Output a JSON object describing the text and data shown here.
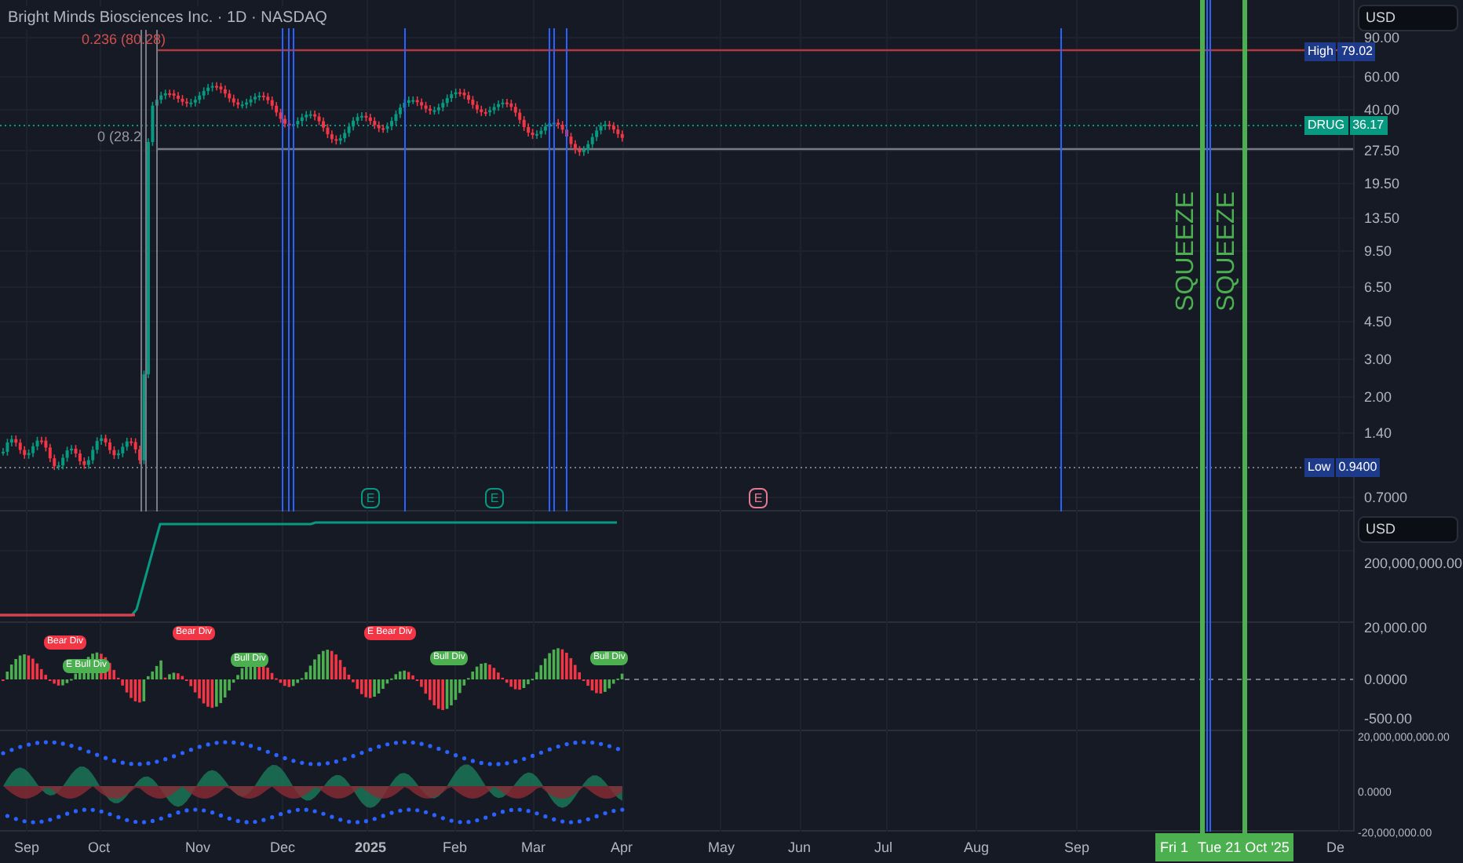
{
  "chart_title": "Bright Minds Biosciences Inc. · 1D · NASDAQ",
  "price_pane": {
    "fib_levels": [
      {
        "kind": "upper",
        "label": "0.236 (80.28)"
      },
      {
        "kind": "base",
        "label": "0 (28.2"
      }
    ],
    "axis_currency": "USD",
    "axis_ticks": [
      "90.00",
      "60.00",
      "40.00",
      "27.50",
      "19.50",
      "13.50",
      "9.50",
      "6.50",
      "4.50",
      "3.00",
      "2.00",
      "1.40",
      "0.7000"
    ],
    "price_labels": [
      {
        "kind": "high",
        "name": "High",
        "value": "79.02"
      },
      {
        "kind": "last",
        "name": "DRUG",
        "value": "36.17"
      },
      {
        "kind": "low",
        "name": "Low",
        "value": "0.9400"
      }
    ],
    "events": [
      {
        "label": "E",
        "color": "#089981"
      },
      {
        "label": "E",
        "color": "#089981"
      },
      {
        "label": "E",
        "color": "#e27a92"
      }
    ],
    "squeeze_labels": [
      "SQUEEZE",
      "SQUEEZE"
    ]
  },
  "volume_pane": {
    "axis_currency": "USD",
    "axis_ticks": [
      "200,000,000.00"
    ]
  },
  "oscillator_pane": {
    "signals": [
      {
        "kind": "bear",
        "label": "Bear Div"
      },
      {
        "kind": "bull",
        "label": "E  Bull Div"
      },
      {
        "kind": "bear",
        "label": "Bear Div"
      },
      {
        "kind": "bull",
        "label": "Bull Div"
      },
      {
        "kind": "bear",
        "label": "E  Bear Div"
      },
      {
        "kind": "bull",
        "label": "Bull Div"
      },
      {
        "kind": "bull",
        "label": "Bull Div"
      }
    ],
    "axis_ticks": [
      "20,000.00",
      "0.0000",
      "-500.00"
    ]
  },
  "flow_pane": {
    "axis_ticks": [
      "20,000,000,000.00",
      "0.0000",
      "-20,000,000.00"
    ]
  },
  "time_axis": {
    "labels": [
      "Sep",
      "Oct",
      "Nov",
      "Dec",
      "2025",
      "Feb",
      "Mar",
      "Apr",
      "May",
      "Jun",
      "Jul",
      "Aug",
      "Sep",
      "De"
    ],
    "cursor_labels": [
      "Fri 1",
      "Tue 21 Oct '25"
    ]
  }
}
